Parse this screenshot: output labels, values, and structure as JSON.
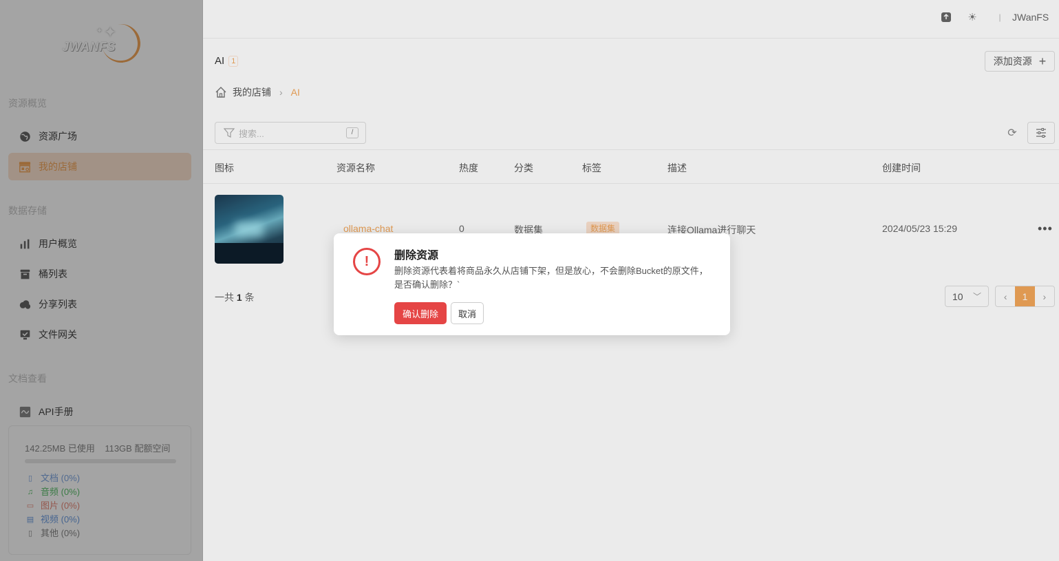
{
  "app": {
    "logo_text": "JWANFS"
  },
  "header": {
    "user_name": "JWanFS"
  },
  "sidebar": {
    "section_overview": "资源概览",
    "section_storage": "数据存储",
    "section_docs": "文档查看",
    "items": [
      {
        "label": "资源广场",
        "icon": "globe-icon"
      },
      {
        "label": "我的店铺",
        "icon": "store-icon",
        "active": true
      },
      {
        "label": "用户概览",
        "icon": "bar-chart-icon"
      },
      {
        "label": "桶列表",
        "icon": "archive-icon"
      },
      {
        "label": "分享列表",
        "icon": "cloud-icon"
      },
      {
        "label": "文件网关",
        "icon": "gateway-icon"
      },
      {
        "label": "API手册",
        "icon": "api-icon"
      }
    ],
    "storage": {
      "used": "142.25MB 已使用",
      "quota": "113GB 配额空间",
      "usage_fraction": 0.0,
      "breakdown": [
        {
          "label": "文档 (0%)",
          "color": "#7ea6e0",
          "icon": "doc-icon"
        },
        {
          "label": "音频 (0%)",
          "color": "#5cbf6c",
          "icon": "music-icon"
        },
        {
          "label": "图片 (0%)",
          "color": "#e88a7a",
          "icon": "image-icon"
        },
        {
          "label": "视频 (0%)",
          "color": "#6d9de0",
          "icon": "video-icon"
        },
        {
          "label": "其他 (0%)",
          "color": "#888888",
          "icon": "file-icon"
        }
      ]
    }
  },
  "main": {
    "title": "AI",
    "count": "1",
    "add_button": "添加资源",
    "breadcrumb": {
      "home": "我的店铺",
      "current": "AI"
    },
    "search_placeholder": "搜索...",
    "search_shortcut": "/",
    "columns": [
      "图标",
      "资源名称",
      "热度",
      "分类",
      "标签",
      "描述",
      "创建时间"
    ],
    "rows": [
      {
        "name": "ollama-chat",
        "heat": "0",
        "category": "数据集",
        "tag": "数据集",
        "description": "连接Ollama进行聊天",
        "created": "2024/05/23 15:29"
      }
    ],
    "total_prefix": "一共",
    "total_count": "1",
    "total_suffix": "条",
    "page_size": "10",
    "current_page": "1"
  },
  "dialog": {
    "title": "删除资源",
    "message": "删除资源代表着将商品永久从店铺下架，但是放心，不会删除Bucket的原文件，是否确认删除？`",
    "confirm": "确认删除",
    "cancel": "取消"
  },
  "colors": {
    "accent": "#f2a65a",
    "danger": "#e54545"
  }
}
